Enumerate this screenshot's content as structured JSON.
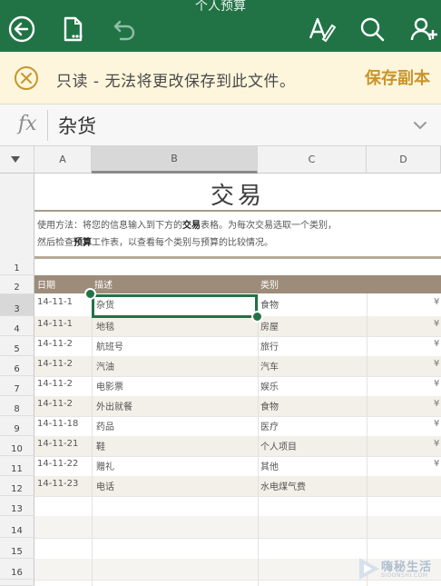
{
  "app": {
    "doc_title": "个人预算",
    "theme_color": "#217346"
  },
  "toolbar": {
    "icons": [
      "back-icon",
      "file-menu-icon",
      "undo-icon",
      "edit-format-icon",
      "search-icon",
      "share-add-person-icon"
    ]
  },
  "banner": {
    "message": "只读 - 无法将更改保存到此文件。",
    "save_copy_label": "保存副本",
    "close_icon": "close-circle-icon",
    "accent_color": "#c8952c"
  },
  "formula_bar": {
    "fx_label": "fx",
    "value": "杂货"
  },
  "columns": [
    "A",
    "B",
    "C",
    "D"
  ],
  "rows": [
    "1",
    "2",
    "3",
    "4",
    "5",
    "6",
    "7",
    "8",
    "9",
    "10",
    "11",
    "12",
    "13",
    "14",
    "15",
    "16"
  ],
  "selected": {
    "column": "B",
    "row": "3"
  },
  "sheet": {
    "title": "交易",
    "instructions": {
      "line1_a": "使用方法：将您的信息输入到下方的",
      "line1_bold": "交易",
      "line1_b": "表格。为每次交易选取一个类别，",
      "line2_a": "然后检查",
      "line2_bold": "预算",
      "line2_b": "工作表，以查看每个类别与预算的比较情况。"
    },
    "table_headers": [
      "日期",
      "描述",
      "类别",
      ""
    ],
    "header_color": "#9c8c79",
    "transactions": [
      {
        "date": "14-11-1",
        "desc": "杂货",
        "category": "食物",
        "amount": "¥"
      },
      {
        "date": "14-11-1",
        "desc": "地毯",
        "category": "房屋",
        "amount": "¥"
      },
      {
        "date": "14-11-2",
        "desc": "航班号",
        "category": "旅行",
        "amount": "¥"
      },
      {
        "date": "14-11-2",
        "desc": "汽油",
        "category": "汽车",
        "amount": "¥"
      },
      {
        "date": "14-11-2",
        "desc": "电影票",
        "category": "娱乐",
        "amount": "¥"
      },
      {
        "date": "14-11-2",
        "desc": "外出就餐",
        "category": "食物",
        "amount": "¥"
      },
      {
        "date": "14-11-18",
        "desc": "药品",
        "category": "医疗",
        "amount": "¥"
      },
      {
        "date": "14-11-21",
        "desc": "鞋",
        "category": "个人项目",
        "amount": "¥"
      },
      {
        "date": "14-11-22",
        "desc": "赠礼",
        "category": "其他",
        "amount": "¥"
      },
      {
        "date": "14-11-23",
        "desc": "电话",
        "category": "水电煤气费",
        "amount": ""
      }
    ]
  },
  "watermark": {
    "text": "嗨秘生活",
    "sub": "SIOONSHI.COM"
  }
}
